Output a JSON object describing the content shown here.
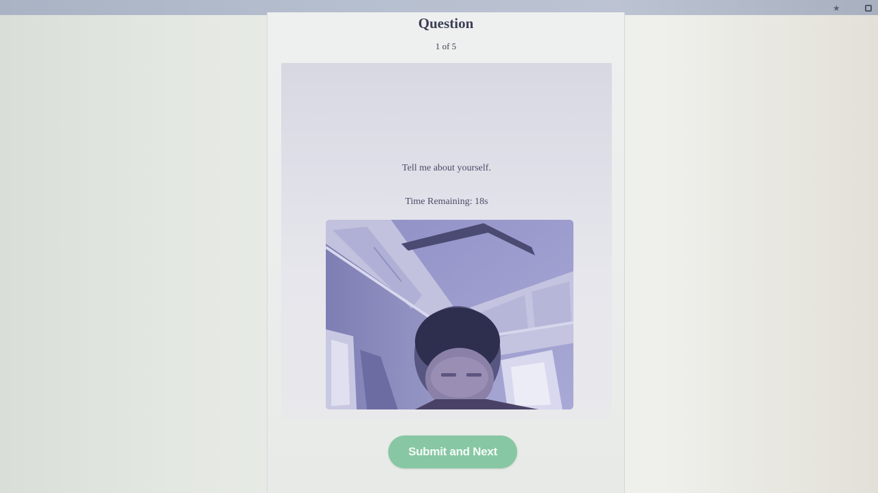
{
  "browser": {
    "bookmark_icon": "star-icon",
    "extensions_icon": "extensions-icon"
  },
  "page": {
    "title": "Question",
    "progress": "1 of 5",
    "question": "Tell me about yourself.",
    "timer": "Time Remaining: 18s",
    "submit_label": "Submit and Next"
  },
  "colors": {
    "submit_button": "#88c7a4",
    "text": "#4a4c68",
    "title": "#3b3e55"
  }
}
